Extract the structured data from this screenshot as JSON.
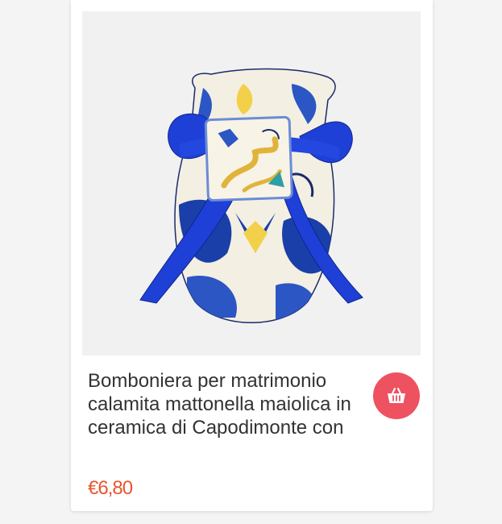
{
  "product": {
    "image_alt": "Bomboniera sacchetto in tessuto maiolica con calamita mattonella",
    "title": "Bomboniera per matrimonio calamita mattonella maiolica in ceramica di Capodimonte con",
    "price": "€6,80"
  },
  "actions": {
    "cart_icon": "basket-icon"
  },
  "colors": {
    "accent": "#ee5260",
    "price": "#e8562f",
    "ribbon": "#1b3fd0"
  }
}
